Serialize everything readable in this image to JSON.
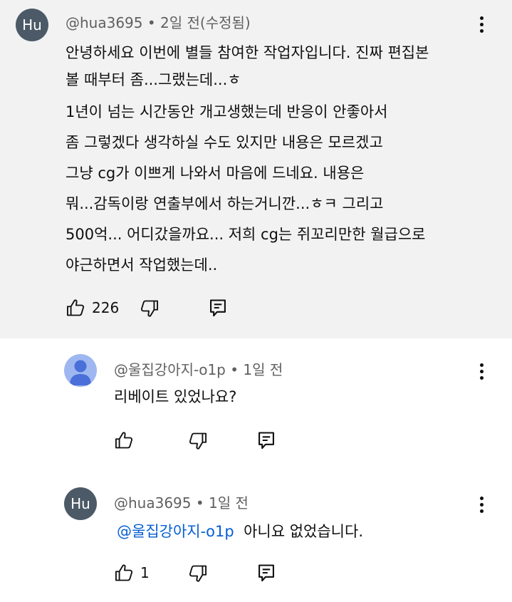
{
  "main": {
    "avatar": "Hu",
    "handle": "@hua3695",
    "sep": "•",
    "time": "2일 전(수정됨)",
    "lines": [
      "안녕하세요 이번에 별들 참여한 작업자입니다. 진짜 편집본",
      "볼 때부터 좀...그랬는데...ㅎ",
      "1년이 넘는 시간동안 개고생했는데 반응이 안좋아서",
      "좀 그렇겠다 생각하실 수도 있지만 내용은 모르겠고",
      "그냥 cg가 이쁘게 나와서 마음에 드네요. 내용은",
      "뭐...감독이랑 연출부에서 하는거니깐...ㅎㅋ 그리고",
      "500억... 어디갔을까요... 저희 cg는 쥐꼬리만한 월급으로",
      "야근하면서 작업했는데.."
    ],
    "likes": "226"
  },
  "reply1": {
    "handle": "@울집강아지-o1p",
    "sep": "•",
    "time": "1일 전",
    "text": "리베이트 있었나요?"
  },
  "reply2": {
    "avatar": "Hu",
    "handle": "@hua3695",
    "sep": "•",
    "time": "1일 전",
    "mention": "@울집강아지-o1p",
    "text": "아니요 없었습니다.",
    "likes": "1"
  },
  "colors": {
    "highlight_bg": "#f2f2f2",
    "avatar_dark": "#4b5a66",
    "avatar_default": "#9fb7f0",
    "mention": "#065fd4",
    "meta": "#606060"
  },
  "icons": [
    "thumb-up-icon",
    "thumb-down-icon",
    "reply-icon",
    "more-vert-icon",
    "default-avatar-icon"
  ]
}
